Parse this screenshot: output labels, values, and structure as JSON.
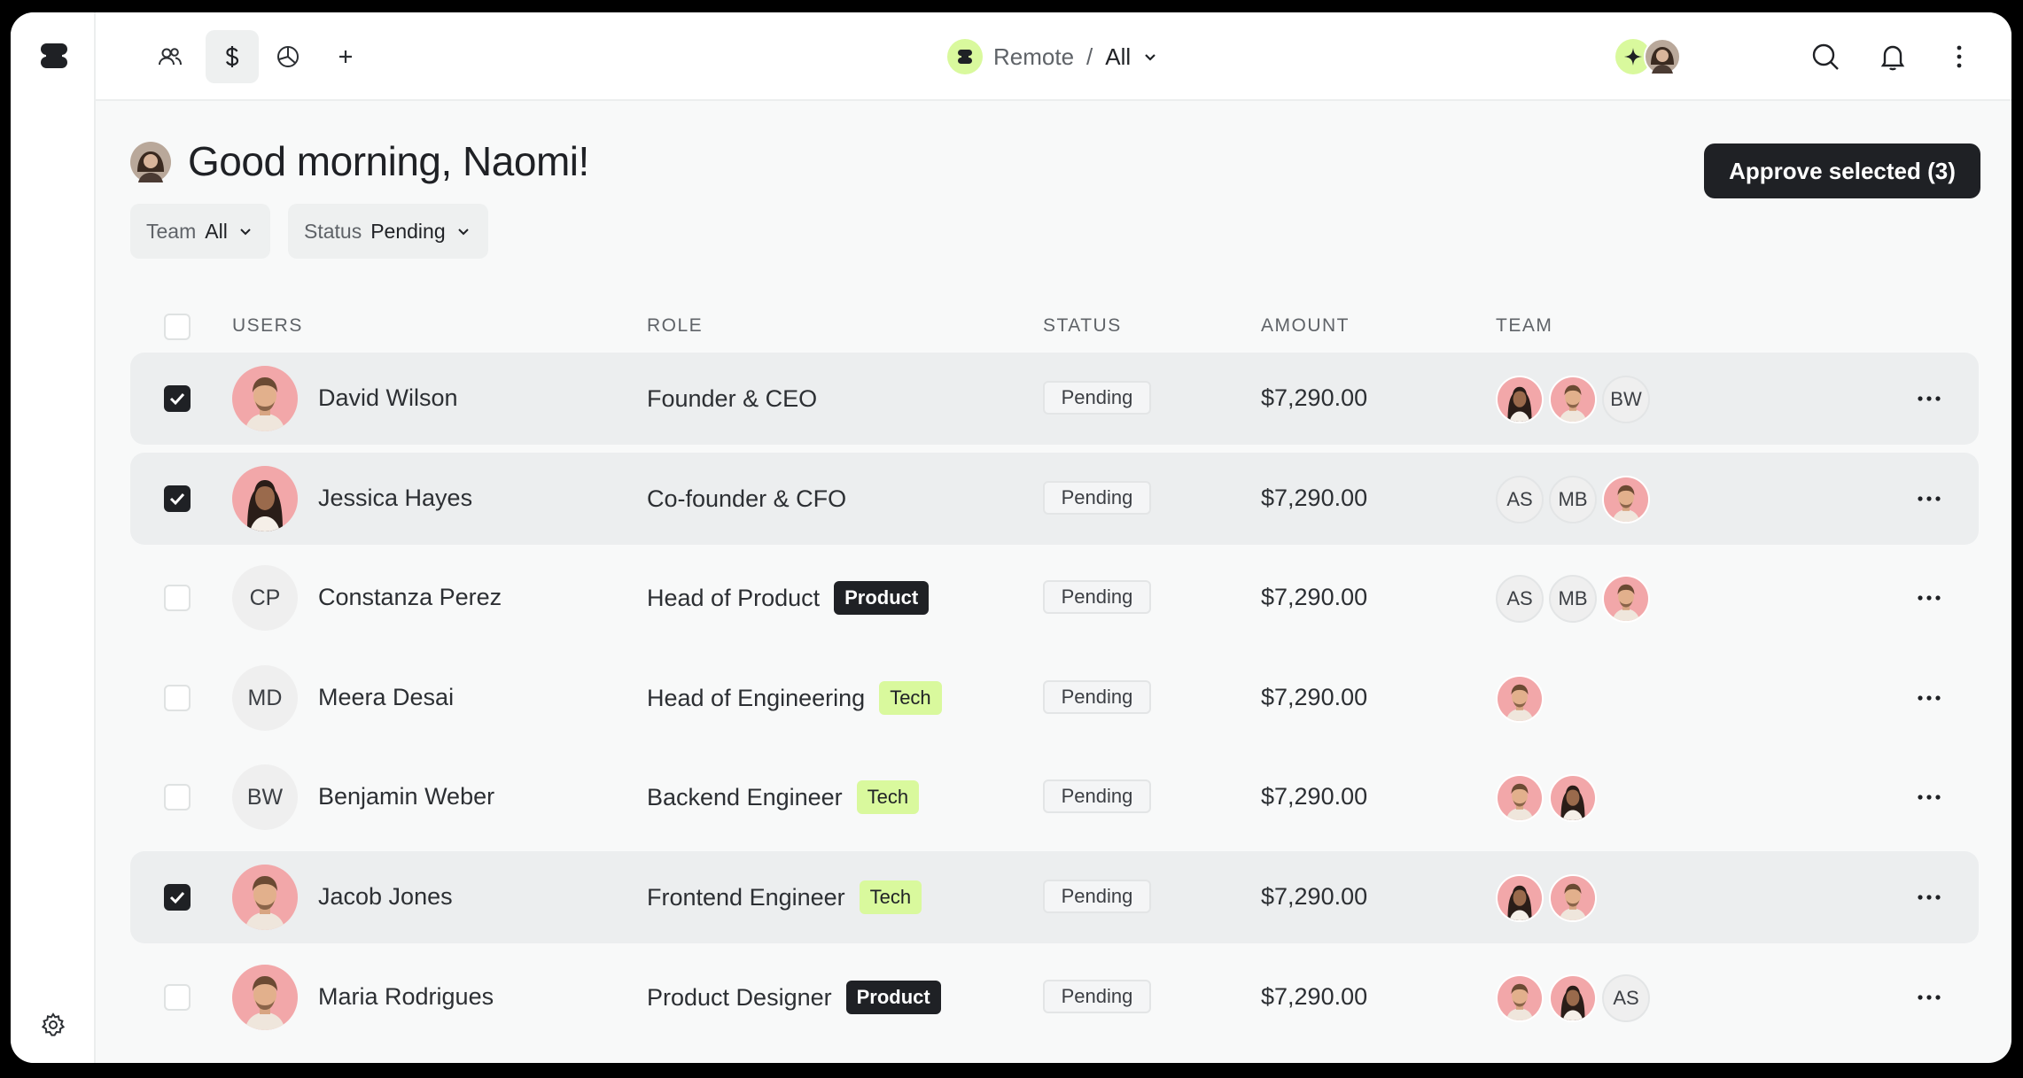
{
  "workspace": {
    "name": "Remote",
    "separator": "/",
    "scope": "All"
  },
  "greeting": "Good morning, Naomi!",
  "approve_button": "Approve selected (3)",
  "filters": [
    {
      "label": "Team",
      "value": "All"
    },
    {
      "label": "Status",
      "value": "Pending"
    }
  ],
  "table": {
    "headers": {
      "users": "USERS",
      "role": "ROLE",
      "status": "STATUS",
      "amount": "AMOUNT",
      "team": "TEAM"
    },
    "rows": [
      {
        "name": "David Wilson",
        "initials": "",
        "avatar": "photo",
        "role": "Founder & CEO",
        "tag": "",
        "status": "Pending",
        "amount": "$7,290.00",
        "selected": true,
        "team": [
          {
            "type": "photo-woman"
          },
          {
            "type": "photo-man"
          },
          {
            "type": "initials",
            "text": "BW"
          }
        ]
      },
      {
        "name": "Jessica Hayes",
        "initials": "",
        "avatar": "photo-woman",
        "role": "Co-founder & CFO",
        "tag": "",
        "status": "Pending",
        "amount": "$7,290.00",
        "selected": true,
        "team": [
          {
            "type": "initials",
            "text": "AS"
          },
          {
            "type": "initials",
            "text": "MB"
          },
          {
            "type": "photo-man"
          }
        ]
      },
      {
        "name": "Constanza Perez",
        "initials": "CP",
        "avatar": "initials",
        "role": "Head of Product",
        "tag": "Product",
        "status": "Pending",
        "amount": "$7,290.00",
        "selected": false,
        "team": [
          {
            "type": "initials",
            "text": "AS"
          },
          {
            "type": "initials",
            "text": "MB"
          },
          {
            "type": "photo-man"
          }
        ]
      },
      {
        "name": "Meera Desai",
        "initials": "MD",
        "avatar": "initials",
        "role": "Head of Engineering",
        "tag": "Tech",
        "status": "Pending",
        "amount": "$7,290.00",
        "selected": false,
        "team": [
          {
            "type": "photo-man"
          }
        ]
      },
      {
        "name": "Benjamin Weber",
        "initials": "BW",
        "avatar": "initials",
        "role": "Backend Engineer",
        "tag": "Tech",
        "status": "Pending",
        "amount": "$7,290.00",
        "selected": false,
        "team": [
          {
            "type": "photo-man"
          },
          {
            "type": "photo-woman"
          }
        ]
      },
      {
        "name": "Jacob Jones",
        "initials": "",
        "avatar": "photo",
        "role": "Frontend Engineer",
        "tag": "Tech",
        "status": "Pending",
        "amount": "$7,290.00",
        "selected": true,
        "team": [
          {
            "type": "photo-woman"
          },
          {
            "type": "photo-man"
          }
        ]
      },
      {
        "name": "Maria Rodrigues",
        "initials": "",
        "avatar": "photo",
        "role": "Product Designer",
        "tag": "Product",
        "status": "Pending",
        "amount": "$7,290.00",
        "selected": false,
        "team": [
          {
            "type": "photo-man"
          },
          {
            "type": "photo-woman"
          },
          {
            "type": "initials",
            "text": "AS"
          }
        ]
      }
    ]
  },
  "colors": {
    "accent": "#d9f99d",
    "dark": "#1f2125",
    "selected_row": "#eceeef",
    "avatar_bg": "#f2a7a9"
  },
  "icons": [
    "logo-icon",
    "users-icon",
    "dollar-icon",
    "pie-chart-icon",
    "plus-icon",
    "chevron-down-icon",
    "sparkle-icon",
    "search-icon",
    "bell-icon",
    "more-vertical-icon",
    "more-horizontal-icon",
    "checkbox-icon",
    "settings-icon"
  ]
}
